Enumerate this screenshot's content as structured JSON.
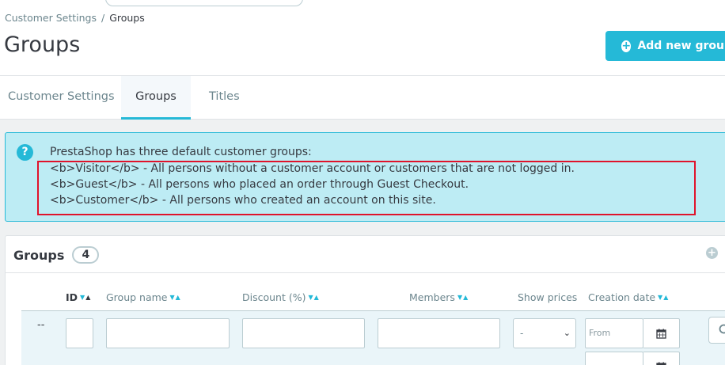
{
  "breadcrumb": {
    "parent": "Customer Settings",
    "separator": "/",
    "current": "Groups"
  },
  "page_title": "Groups",
  "toolbar": {
    "add_label": "Add new group"
  },
  "tabs": [
    {
      "label": "Customer Settings",
      "active": false
    },
    {
      "label": "Groups",
      "active": true
    },
    {
      "label": "Titles",
      "active": false
    }
  ],
  "alert": {
    "icon": "?",
    "lines": [
      "PrestaShop has three default customer groups:",
      "<b>Visitor</b> - All persons without a customer account or customers that are not logged in.",
      "<b>Guest</b> - All persons who placed an order through Guest Checkout.",
      "<b>Customer</b> - All persons who created an account on this site."
    ]
  },
  "panel": {
    "title": "Groups",
    "count": "4"
  },
  "columns": [
    {
      "label": "ID"
    },
    {
      "label": "Group name"
    },
    {
      "label": "Discount (%)"
    },
    {
      "label": "Members"
    },
    {
      "label": "Show prices"
    },
    {
      "label": "Creation date"
    }
  ],
  "filters": {
    "row_marker": "--",
    "show_prices_value": "-",
    "date_from_placeholder": "From"
  },
  "colors": {
    "accent": "#25b9d7",
    "highlight": "#e0132b",
    "alert_bg": "#bdecf4"
  }
}
